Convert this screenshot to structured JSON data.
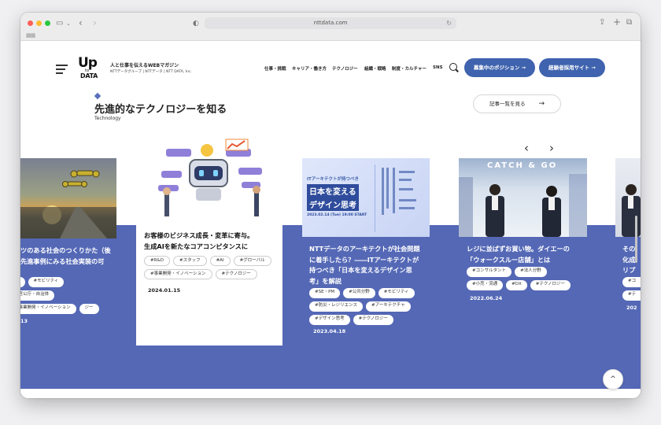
{
  "browser": {
    "url": "nttdata.com",
    "icons": {
      "back": "chevron-left-icon",
      "forward": "chevron-right-icon",
      "sidebar": "sidebar-icon",
      "shield": "shield-icon",
      "share": "share-icon",
      "new_tab": "plus-icon",
      "tabs": "tabs-icon",
      "reload": "reload-icon"
    }
  },
  "header": {
    "logo_up": "Up",
    "logo_to": "to",
    "logo_data": "DATA",
    "tagline": "人と仕事を伝えるWEBマガジン",
    "company": "NTTデータグループ | NTTデータ | NTT DATA, Inc.",
    "nav": [
      "仕事・挑戦",
      "キャリア・働き方",
      "テクノロジー",
      "組織・戦略",
      "制度・カルチャー",
      "SNS"
    ],
    "buttons": {
      "positions": "募集中のポジション →",
      "career": "経験者採用サイト →"
    }
  },
  "section": {
    "title": "先進的なテクノロジーを知る",
    "subtitle": "Technology",
    "all_link": "記事一覧を見る",
    "all_arrow": "→",
    "prev": "‹",
    "next": "›"
  },
  "cards": [
    {
      "title": "ツのある社会のつくりかた（後\n先進事例にみる社会実装の可",
      "tags": [
        "ビ",
        "#モビリティ",
        "#官公庁・自治体",
        "#事業開発・イノベーション",
        "ジー"
      ],
      "date": "13"
    },
    {
      "title": "お客様のビジネス成長・変革に寄与。\n生成AIを新たなコアコンピタンスに",
      "tags": [
        "#R&D",
        "#スタッフ",
        "#AI",
        "#グローバル",
        "#事業開発・イノベーション",
        "#テクノロジー"
      ],
      "date": "2024.01.15"
    },
    {
      "title": "NTTデータのアーキテクトが社会問題\nに着手したら？――ITアーキテクトが\n持つべき「日本を変えるデザイン思\n考」を解説",
      "image_text": {
        "line1": "ITアーキテクトが持つべき",
        "line2": "日本を変える",
        "line3": "デザイン思考",
        "date": "2023.02.14 (Tue) 19:00 START"
      },
      "tags": [
        "#SE・PM",
        "#公共分野",
        "#モビリティ",
        "#防災・レジリエンス",
        "#アーキテクチャ",
        "#デザイン思考",
        "#テクノロジー"
      ],
      "date": "2023.04.18"
    },
    {
      "title": "レジに並ばずお買い物。ダイエーの\n「ウォークスルー店舗」とは",
      "image_text": "CATCH & GO",
      "tags": [
        "#コンサルタント",
        "#法人分野",
        "#小売・流通",
        "#DX",
        "#テクノロジー"
      ],
      "date": "2022.06.24"
    },
    {
      "title": "その\n化成\nリプ",
      "tags": [
        "#コ",
        "#テ"
      ],
      "date": "202"
    }
  ],
  "ui": {
    "to_top": "^"
  },
  "colors": {
    "accent": "#3f63ae",
    "band": "#5468b6",
    "date_blue": "#3f5faa"
  }
}
